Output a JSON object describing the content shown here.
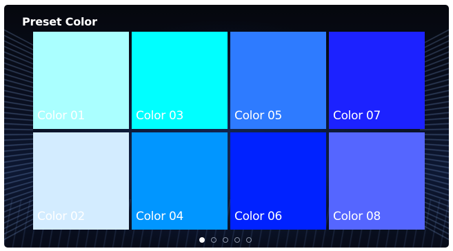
{
  "header": {
    "title": "Preset Color"
  },
  "swatches": [
    {
      "label": "Color 01",
      "color": "#aaffff"
    },
    {
      "label": "Color 03",
      "color": "#00ffff"
    },
    {
      "label": "Color 05",
      "color": "#2e7bff"
    },
    {
      "label": "Color 07",
      "color": "#1c22ff"
    },
    {
      "label": "Color 02",
      "color": "#d3ecff"
    },
    {
      "label": "Color 04",
      "color": "#0196ff"
    },
    {
      "label": "Color 06",
      "color": "#0022ff"
    },
    {
      "label": "Color 08",
      "color": "#5566ff"
    }
  ],
  "pagination": {
    "total": 5,
    "active": 1
  }
}
